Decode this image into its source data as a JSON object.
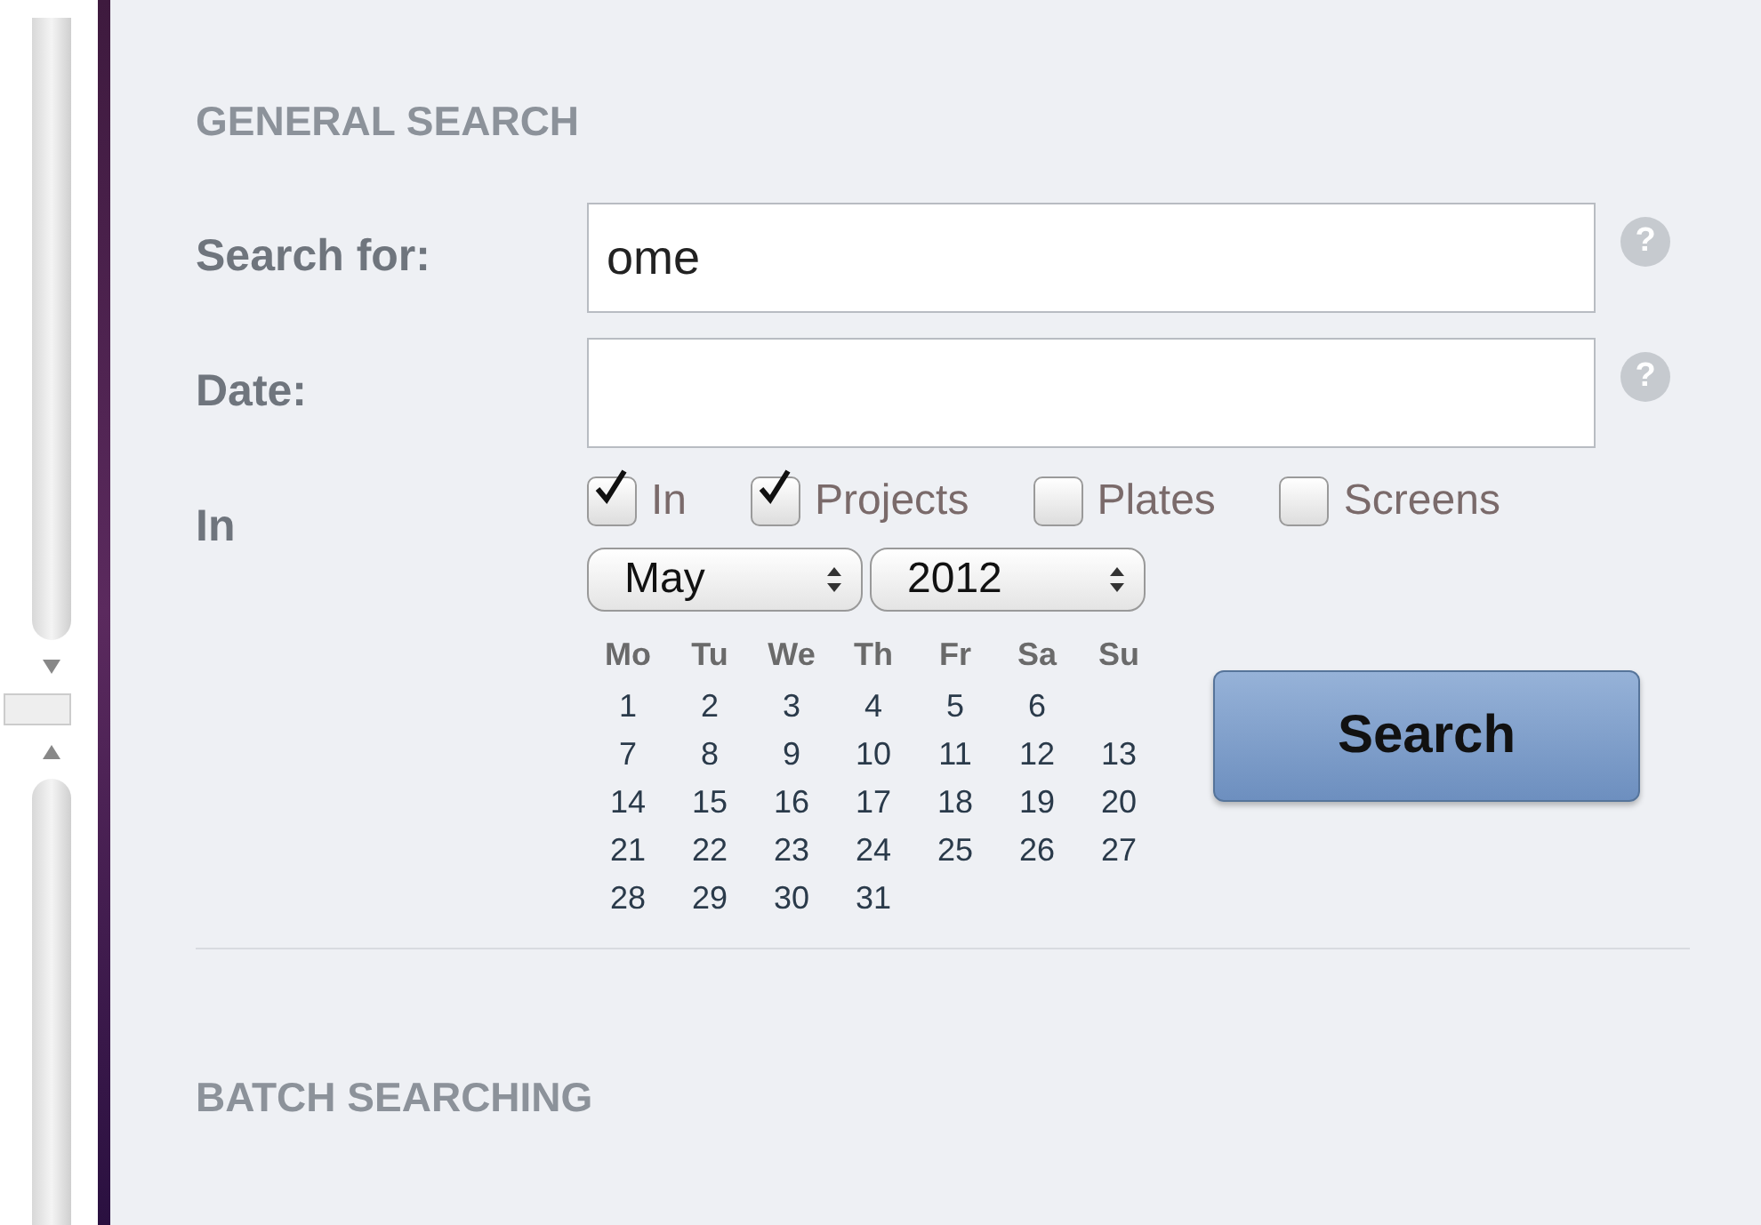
{
  "general_search": {
    "heading": "GENERAL SEARCH",
    "fields": [
      {
        "label": "Search for:",
        "value": "ome",
        "help": "?"
      },
      {
        "label": "Date:",
        "help": "?"
      }
    ],
    "in_label": "In",
    "options": [
      {
        "label": "In",
        "checked": true
      },
      {
        "label": "Projects",
        "checked": true
      },
      {
        "label": "Plates",
        "checked": false
      },
      {
        "label": "Screens",
        "checked": false
      }
    ],
    "date_picker": {
      "month": "May",
      "year": "2012",
      "weekdays": [
        "Mo",
        "Tu",
        "We",
        "Th",
        "Fr",
        "Sa",
        "Su"
      ],
      "weeks": [
        [
          "1",
          "2",
          "3",
          "4",
          "5",
          "6"
        ],
        [
          "7",
          "8",
          "9",
          "10",
          "11",
          "12",
          "13"
        ],
        [
          "14",
          "15",
          "16",
          "17",
          "18",
          "19",
          "20"
        ],
        [
          "21",
          "22",
          "23",
          "24",
          "25",
          "26",
          "27"
        ],
        [
          "28",
          "29",
          "30",
          "31"
        ]
      ]
    },
    "search_button": "Search"
  },
  "batch_searching": {
    "heading": "BATCH SEARCHING"
  }
}
